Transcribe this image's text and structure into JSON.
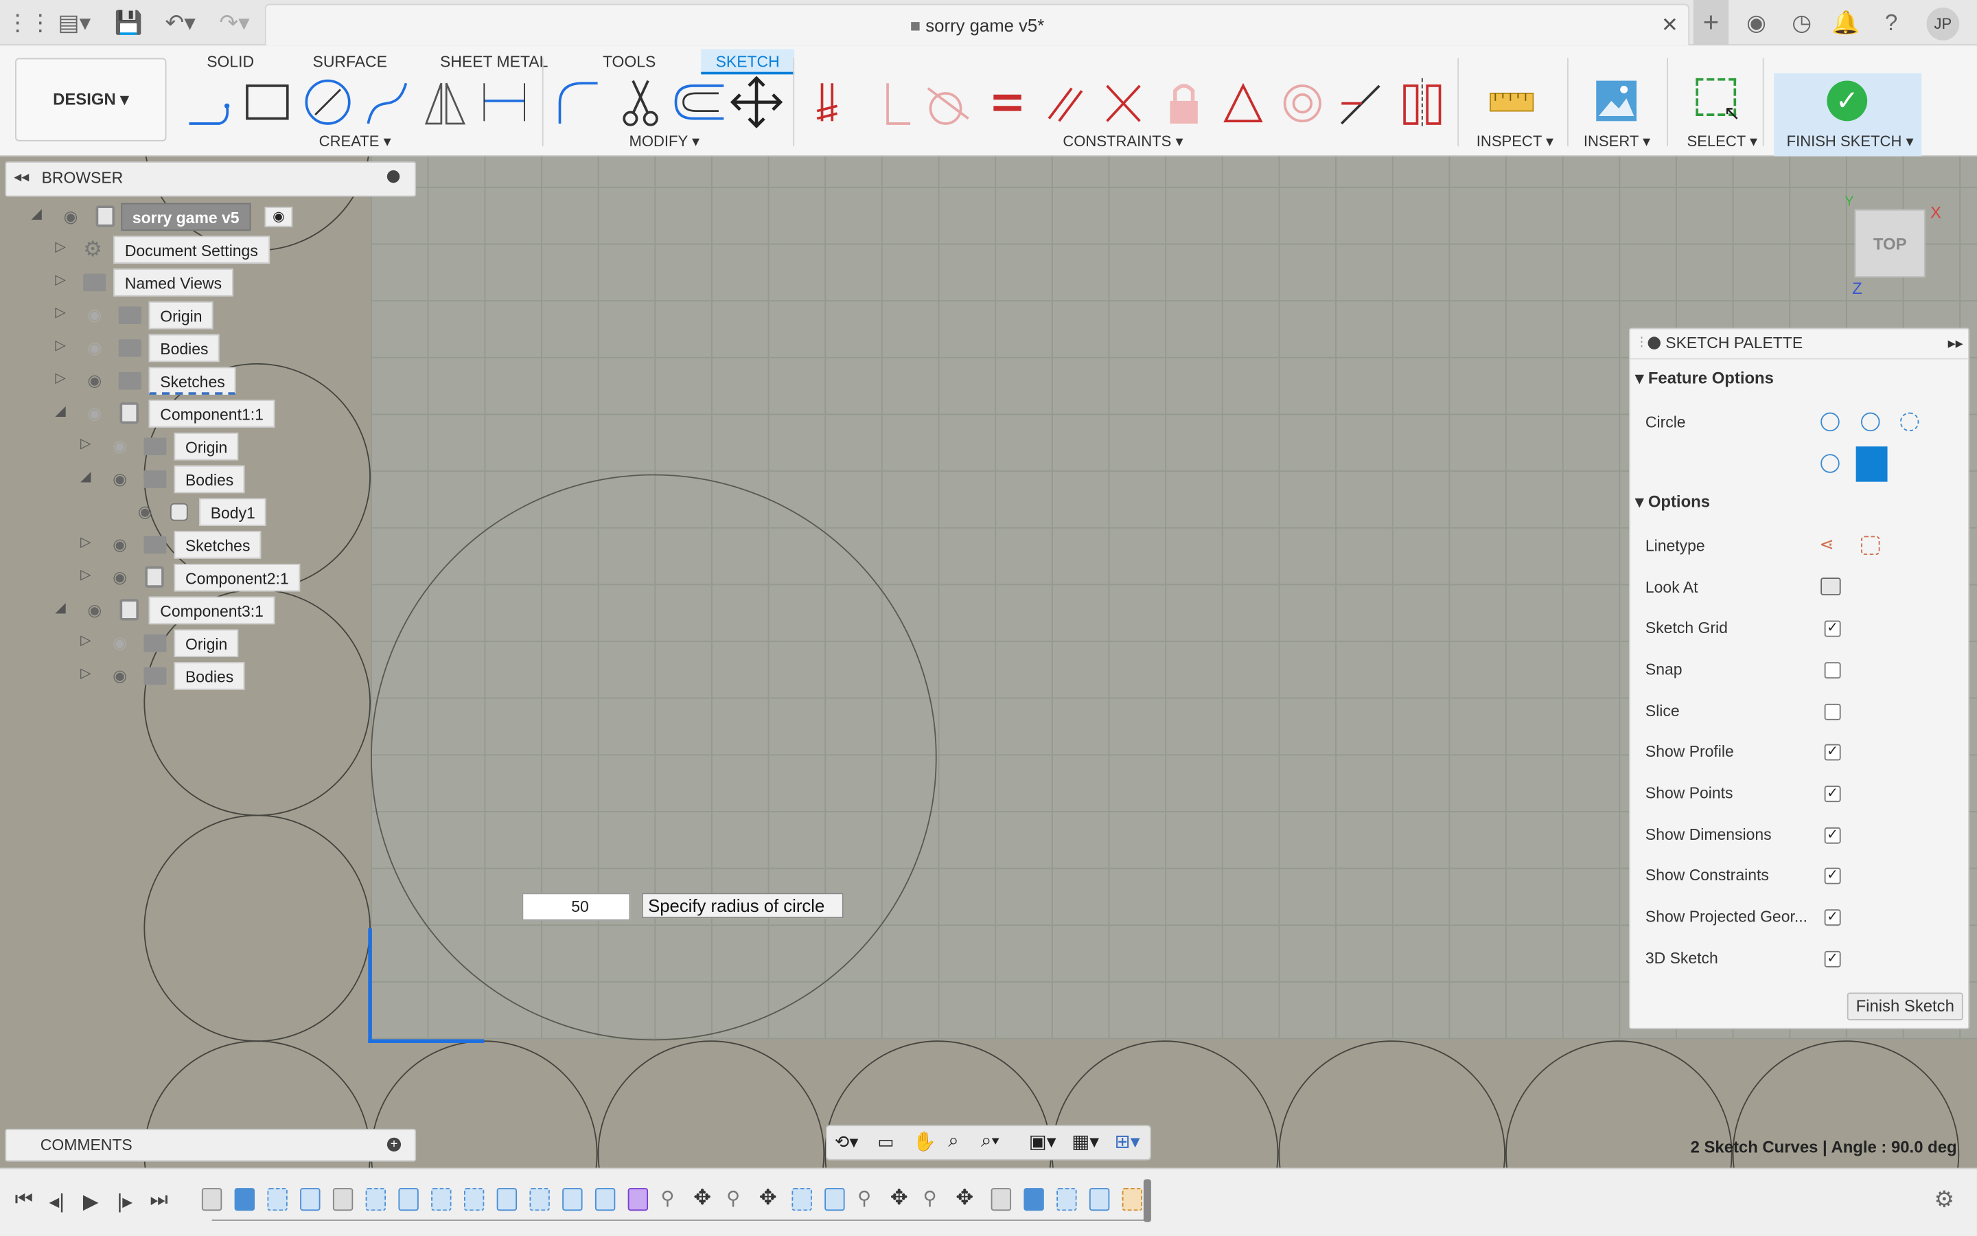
{
  "title_bar": {
    "document_title": "sorry game v5*",
    "user_initials": "JP"
  },
  "ribbon": {
    "tabs": [
      {
        "label": "SOLID"
      },
      {
        "label": "SURFACE"
      },
      {
        "label": "SHEET METAL"
      },
      {
        "label": "TOOLS"
      },
      {
        "label": "SKETCH",
        "active": true
      }
    ],
    "workspace": "DESIGN",
    "groups": {
      "create": "CREATE",
      "modify": "MODIFY",
      "constraints": "CONSTRAINTS",
      "inspect": "INSPECT",
      "insert": "INSERT",
      "select": "SELECT",
      "finish": "FINISH SKETCH"
    }
  },
  "browser": {
    "title": "BROWSER",
    "items": [
      {
        "label": "sorry game v5"
      },
      {
        "label": "Document Settings"
      },
      {
        "label": "Named Views"
      },
      {
        "label": "Origin"
      },
      {
        "label": "Bodies"
      },
      {
        "label": "Sketches"
      },
      {
        "label": "Component1:1"
      },
      {
        "label": "Origin"
      },
      {
        "label": "Bodies"
      },
      {
        "label": "Body1"
      },
      {
        "label": "Sketches"
      },
      {
        "label": "Component2:1"
      },
      {
        "label": "Component3:1"
      },
      {
        "label": "Origin"
      },
      {
        "label": "Bodies"
      }
    ]
  },
  "viewcube": {
    "face": "TOP",
    "x_axis": "X",
    "y_axis": "Y",
    "z_axis": "Z"
  },
  "radius_input": {
    "value": "50",
    "tooltip": "Specify radius of circle"
  },
  "sketch_palette": {
    "title": "SKETCH PALETTE",
    "feature_options_heading": "Feature Options",
    "circle_label": "Circle",
    "options_heading": "Options",
    "rows": [
      {
        "label": "Linetype",
        "kind": "icons"
      },
      {
        "label": "Look At",
        "kind": "icon"
      },
      {
        "label": "Sketch Grid",
        "checked": true
      },
      {
        "label": "Snap",
        "checked": false
      },
      {
        "label": "Slice",
        "checked": false
      },
      {
        "label": "Show Profile",
        "checked": true
      },
      {
        "label": "Show Points",
        "checked": true
      },
      {
        "label": "Show Dimensions",
        "checked": true
      },
      {
        "label": "Show Constraints",
        "checked": true
      },
      {
        "label": "Show Projected Geor...",
        "checked": true
      },
      {
        "label": "3D Sketch",
        "checked": true
      }
    ],
    "finish_button": "Finish Sketch"
  },
  "comments": {
    "title": "COMMENTS"
  },
  "status_bar": {
    "text": "2 Sketch Curves | Angle : 90.0 deg"
  },
  "colors": {
    "accent": "#0a7fd9",
    "finish_green": "#2fb34a",
    "sketch_blue": "#1f6fe0",
    "selected_tree": "#8d8d8d"
  }
}
